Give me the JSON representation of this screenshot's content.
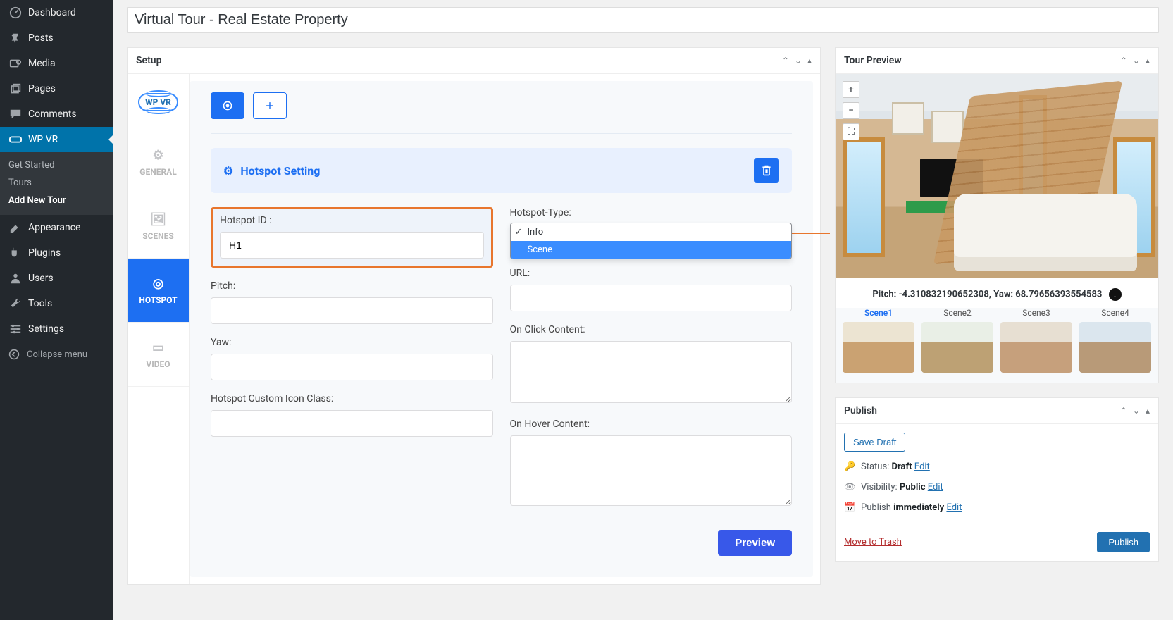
{
  "sidebar": {
    "items": [
      {
        "icon": "dashboard",
        "label": "Dashboard"
      },
      {
        "icon": "pin",
        "label": "Posts"
      },
      {
        "icon": "media",
        "label": "Media"
      },
      {
        "icon": "page",
        "label": "Pages"
      },
      {
        "icon": "comment",
        "label": "Comments"
      },
      {
        "icon": "vr",
        "label": "WP VR"
      },
      {
        "icon": "appearance",
        "label": "Appearance"
      },
      {
        "icon": "plugin",
        "label": "Plugins"
      },
      {
        "icon": "users",
        "label": "Users"
      },
      {
        "icon": "tools",
        "label": "Tools"
      },
      {
        "icon": "settings",
        "label": "Settings"
      }
    ],
    "submenu": [
      "Get Started",
      "Tours",
      "Add New Tour"
    ],
    "collapse": "Collapse menu"
  },
  "title": "Virtual Tour - Real Estate Property",
  "setup": {
    "heading": "Setup",
    "tabs": {
      "general": "GENERAL",
      "scenes": "SCENES",
      "hotspot": "HOTSPOT",
      "video": "VIDEO"
    },
    "logo": "WP VR",
    "hotspot_bar": "Hotspot Setting",
    "labels": {
      "hotspot_id": "Hotspot ID :",
      "hotspot_type": "Hotspot-Type:",
      "pitch": "Pitch:",
      "yaw": "Yaw:",
      "icon_class": "Hotspot Custom Icon Class:",
      "url": "URL:",
      "on_click": "On Click Content:",
      "on_hover": "On Hover Content:"
    },
    "values": {
      "hotspot_id": "H1",
      "pitch": "",
      "yaw": "",
      "icon_class": "",
      "url": "",
      "on_click": "",
      "on_hover": ""
    },
    "type_options": [
      "Info",
      "Scene"
    ],
    "preview_btn": "Preview"
  },
  "preview_box": {
    "heading": "Tour Preview",
    "coords_label_pitch": "Pitch: ",
    "coords_label_yaw": ", Yaw: ",
    "pitch": "-4.310832190652308",
    "yaw": "68.79656393554583",
    "scenes": [
      "Scene1",
      "Scene2",
      "Scene3",
      "Scene4"
    ]
  },
  "publish": {
    "heading": "Publish",
    "save_draft": "Save Draft",
    "status_label": "Status: ",
    "status_value": "Draft",
    "visibility_label": "Visibility: ",
    "visibility_value": "Public",
    "publish_label": "Publish ",
    "publish_value": "immediately",
    "edit": "Edit",
    "trash": "Move to Trash",
    "publish_btn": "Publish"
  }
}
